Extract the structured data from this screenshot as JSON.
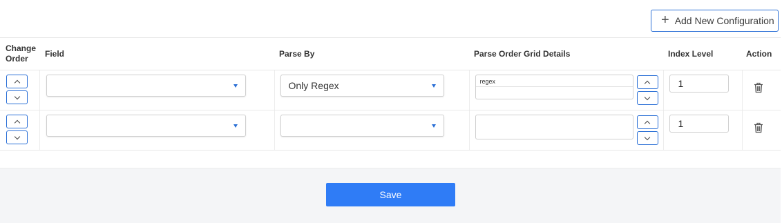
{
  "toolbar": {
    "add_label": "Add New Configuration",
    "add_icon": "plus-icon"
  },
  "table": {
    "headers": {
      "change_order": "Change Order",
      "field": "Field",
      "parse_by": "Parse By",
      "parse_details": "Parse Order Grid Details",
      "index_level": "Index Level",
      "action": "Action"
    },
    "rows": [
      {
        "field": "",
        "parse_by": "Only Regex",
        "details": "regex",
        "index": "1"
      },
      {
        "field": "",
        "parse_by": "",
        "details": "",
        "index": "1"
      }
    ]
  },
  "footer": {
    "save_label": "Save"
  },
  "colors": {
    "accent": "#2f7cf6",
    "border_accent": "#2a6fd6",
    "footer_bg": "#f4f5f7"
  }
}
